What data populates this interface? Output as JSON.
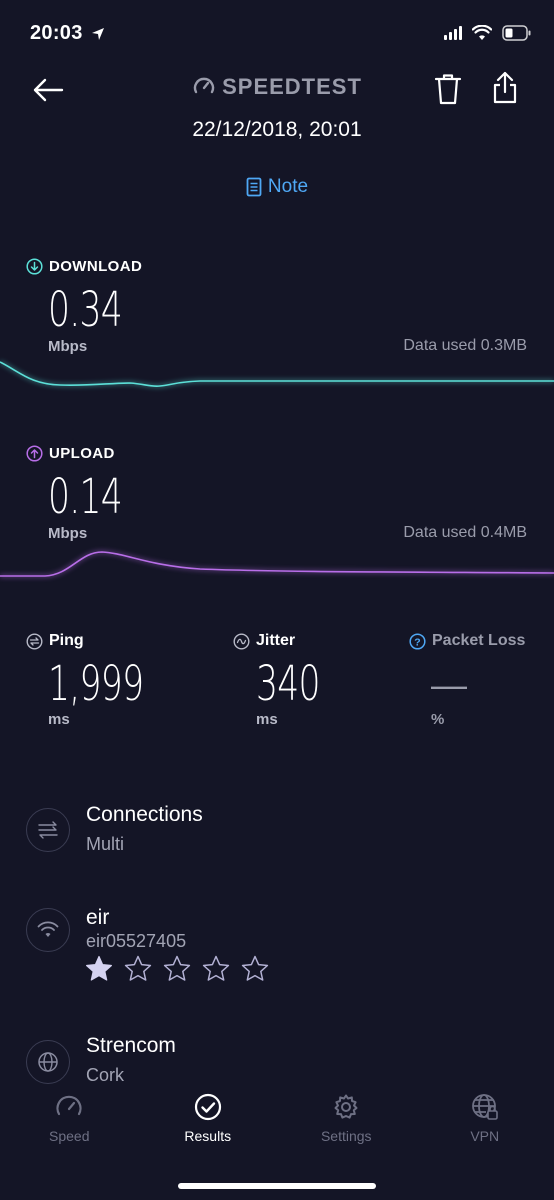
{
  "status_bar": {
    "time": "20:03"
  },
  "header": {
    "brand": "SPEEDTEST",
    "date": "22/12/2018, 20:01",
    "note_label": "Note"
  },
  "download": {
    "label": "DOWNLOAD",
    "value": "0.34",
    "unit": "Mbps",
    "data_used": "Data used 0.3MB",
    "color": "#5ce0d8"
  },
  "upload": {
    "label": "UPLOAD",
    "value": "0.14",
    "unit": "Mbps",
    "data_used": "Data used 0.4MB",
    "color": "#b86ee8"
  },
  "ping": {
    "label": "Ping",
    "value": "1,999",
    "unit": "ms"
  },
  "jitter": {
    "label": "Jitter",
    "value": "340",
    "unit": "ms"
  },
  "packet_loss": {
    "label": "Packet Loss",
    "value": "—",
    "unit": "%",
    "color": "#4fa8f5"
  },
  "connections": {
    "title": "Connections",
    "subtitle": "Multi"
  },
  "network": {
    "title": "eir",
    "subtitle": "eir05527405",
    "rating": 1,
    "rating_max": 5
  },
  "server": {
    "title": "Strencom",
    "subtitle": "Cork"
  },
  "tabs": [
    {
      "label": "Speed",
      "icon": "speedometer-icon"
    },
    {
      "label": "Results",
      "icon": "check-circle-icon"
    },
    {
      "label": "Settings",
      "icon": "gear-icon"
    },
    {
      "label": "VPN",
      "icon": "globe-lock-icon"
    }
  ]
}
